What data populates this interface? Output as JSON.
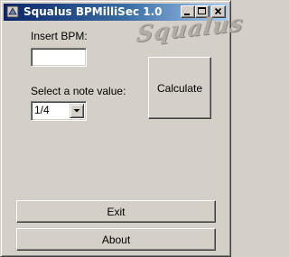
{
  "window": {
    "title": "Squalus BPMilliSec 1.0",
    "icon": "app-icon",
    "controls": [
      "minimize-icon",
      "maximize-icon",
      "close-icon"
    ]
  },
  "logo": {
    "text": "Squalus"
  },
  "form": {
    "bpm_label": "Insert BPM:",
    "bpm_value": "",
    "bpm_placeholder": "",
    "note_label": "Select a note value:",
    "note_selected": "1/4"
  },
  "buttons": {
    "calculate": "Calculate",
    "exit": "Exit",
    "about": "About"
  },
  "colors": {
    "face": "#d4d0c8",
    "title_start": "#0a246a",
    "title_end": "#a6caf0",
    "logo": "#b0aca4"
  }
}
